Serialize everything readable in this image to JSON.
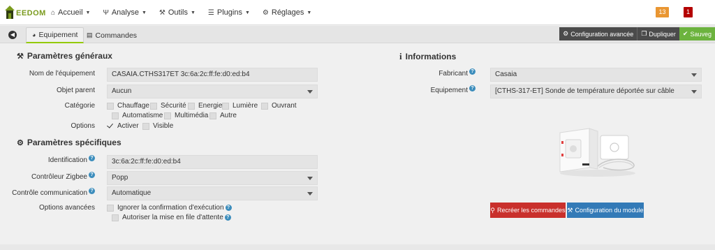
{
  "app": {
    "brand": "EEDOM"
  },
  "nav": {
    "items": [
      {
        "label": "Accueil",
        "icon": "home-icon"
      },
      {
        "label": "Analyse",
        "icon": "analyse-icon"
      },
      {
        "label": "Outils",
        "icon": "wrench-icon"
      },
      {
        "label": "Plugins",
        "icon": "list-icon"
      },
      {
        "label": "Réglages",
        "icon": "gear-icon"
      }
    ],
    "badge_orange": "13",
    "badge_red": "1"
  },
  "tabs": {
    "equipement": "Equipement",
    "commandes": "Commandes"
  },
  "actions": {
    "config_avancee": "Configuration avancée",
    "dupliquer": "Dupliquer",
    "sauvegarder": "Sauveg"
  },
  "general": {
    "title": "Paramètres généraux",
    "nom_label": "Nom de l'équipement",
    "nom_value": "CASAIA.CTHS317ET 3c:6a:2c:ff:fe:d0:ed:b4",
    "objet_label": "Objet parent",
    "objet_value": "Aucun",
    "categorie_label": "Catégorie",
    "categories": [
      "Chauffage",
      "Sécurité",
      "Energie",
      "Lumière",
      "Ouvrant",
      "Automatisme",
      "Multimédia",
      "Autre"
    ],
    "options_label": "Options",
    "options": [
      "Activer",
      "Visible"
    ]
  },
  "specific": {
    "title": "Paramètres spécifiques",
    "identification_label": "Identification",
    "identification_value": "3c:6a:2c:ff:fe:d0:ed:b4",
    "controleur_label": "Contrôleur Zigbee",
    "controleur_value": "Popp",
    "communication_label": "Contrôle communication",
    "communication_value": "Automatique",
    "options_avancees_label": "Options avancées",
    "option1": "Ignorer la confirmation d'exécution",
    "option2": "Autoriser la mise en file d'attente"
  },
  "informations": {
    "title": "Informations",
    "fabricant_label": "Fabricant",
    "fabricant_value": "Casaia",
    "equipement_label": "Equipement",
    "equipement_value": "[CTHS-317-ET] Sonde de température déportée sur câble"
  },
  "buttons": {
    "recreer": "Recréer les commandes",
    "configuration": "Configuration du module"
  },
  "colors": {
    "accent_green": "#94ca02",
    "badge_orange": "#e99632",
    "badge_red": "#b40000",
    "danger": "#c9302c",
    "primary": "#337ab7",
    "success": "#6cb33e"
  }
}
